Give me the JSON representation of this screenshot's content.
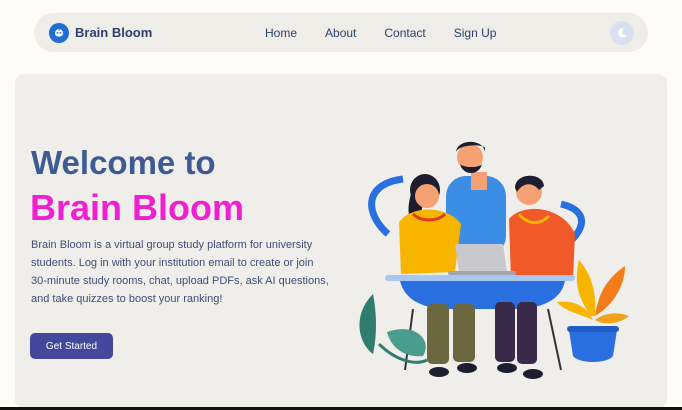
{
  "navbar": {
    "brand_name": "Brain Bloom",
    "logo_icon": "brain-icon",
    "links": [
      {
        "label": "Home"
      },
      {
        "label": "About"
      },
      {
        "label": "Contact"
      },
      {
        "label": "Sign Up"
      }
    ],
    "theme_toggle_icon": "moon-icon"
  },
  "hero": {
    "title_line1": "Welcome to",
    "title_line2": "Brain Bloom",
    "description": "Brain Bloom is a virtual group study platform for university students. Log in with your institution email to create or join 30-minute study rooms, chat, upload PDFs, ask AI questions, and take quizzes to boost your ranking!",
    "cta_label": "Get Started",
    "illustration": "students-studying-illustration"
  },
  "colors": {
    "accent_pink": "#f01fd1",
    "heading_blue": "#3e5a93",
    "button_indigo": "#43489c",
    "logo_blue": "#1f6ed4"
  }
}
